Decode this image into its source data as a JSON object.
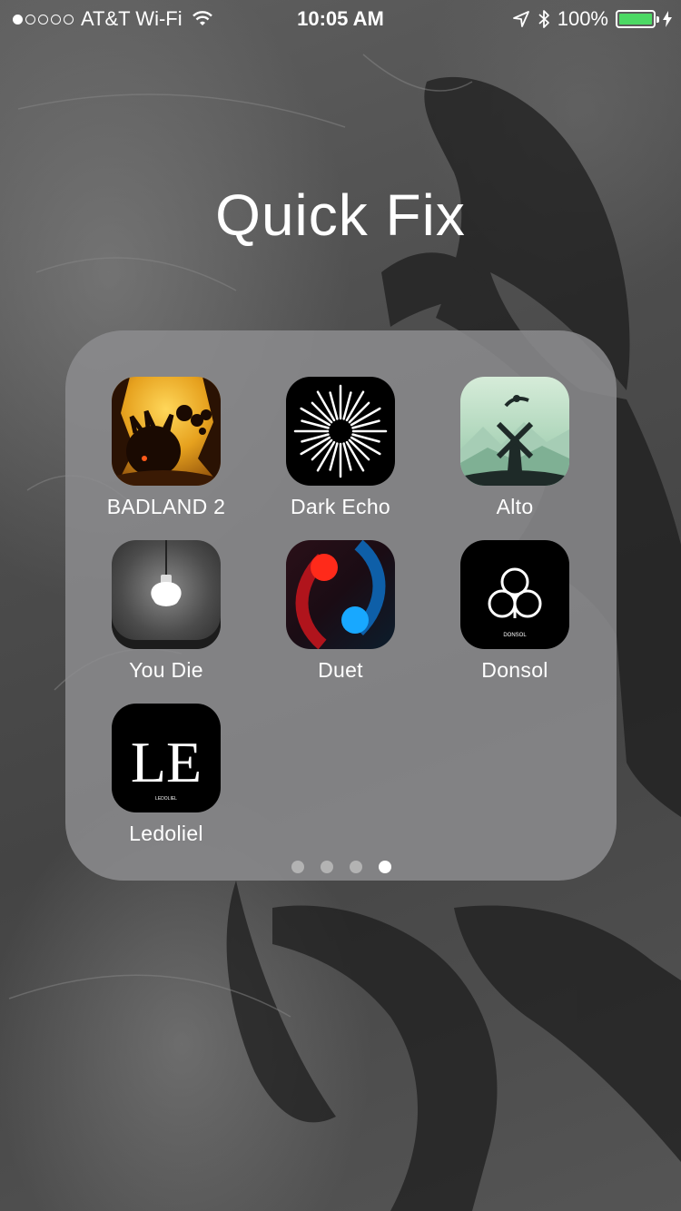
{
  "status_bar": {
    "signal_filled": 1,
    "signal_total": 5,
    "carrier": "AT&T Wi-Fi",
    "time": "10:05 AM",
    "battery_percent": "100%",
    "battery_level": 1.0,
    "battery_color": "#4cd964"
  },
  "folder": {
    "title": "Quick Fix",
    "apps": [
      {
        "label": "BADLAND 2",
        "icon": "badland-2-icon"
      },
      {
        "label": "Dark Echo",
        "icon": "dark-echo-icon"
      },
      {
        "label": "Alto",
        "icon": "alto-icon"
      },
      {
        "label": "You Die",
        "icon": "you-die-icon"
      },
      {
        "label": "Duet",
        "icon": "duet-icon"
      },
      {
        "label": "Donsol",
        "icon": "donsol-icon"
      },
      {
        "label": "Ledoliel",
        "icon": "ledoliel-icon"
      }
    ],
    "page_count": 4,
    "current_page": 4
  },
  "icon_text": {
    "donsol": "DONSOL",
    "ledoliel_mark": "LE",
    "ledoliel_small": "LEDOLIEL"
  }
}
